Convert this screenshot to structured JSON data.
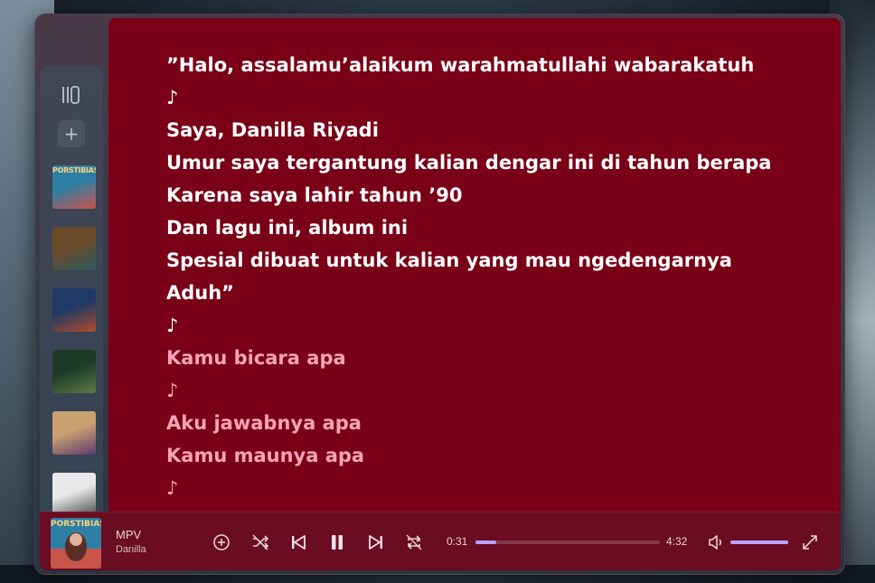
{
  "colors": {
    "lyrics_background": "#790016",
    "player_background": "#6a0c22",
    "lyric_active": "#ffffff",
    "lyric_upcoming": "#f6a3b4",
    "accent": "#b9a3ff"
  },
  "sidebar": {
    "library_icon": "library-icon",
    "add_icon": "plus-icon",
    "albums": [
      {
        "name": "album-porstibias",
        "caption": "PORSTIBIAS",
        "c1": "#2e7fa5",
        "c2": "#c9544a"
      },
      {
        "name": "album-2",
        "caption": "",
        "c1": "#6b4a2a",
        "c2": "#2e5b5e"
      },
      {
        "name": "album-3",
        "caption": "",
        "c1": "#1f3a66",
        "c2": "#b24a2a"
      },
      {
        "name": "album-4",
        "caption": "",
        "c1": "#1e3b28",
        "c2": "#5c7a46"
      },
      {
        "name": "album-5",
        "caption": "",
        "c1": "#c9a070",
        "c2": "#5a3a6c"
      },
      {
        "name": "album-6",
        "caption": "",
        "c1": "#e8e8e8",
        "c2": "#4a4a4a"
      }
    ]
  },
  "lyrics": [
    {
      "text": "”Halo, assalamu’alaikum warahmatullahi wabarakatuh",
      "state": "past"
    },
    {
      "text": "♪",
      "state": "past"
    },
    {
      "text": "Saya, Danilla Riyadi",
      "state": "past"
    },
    {
      "text": "Umur saya tergantung kalian dengar ini di tahun berapa",
      "state": "past"
    },
    {
      "text": "Karena saya lahir tahun ’90",
      "state": "past"
    },
    {
      "text": "Dan lagu ini, album ini",
      "state": "past"
    },
    {
      "text": "Spesial dibuat untuk kalian yang mau ngedengarnya",
      "state": "past"
    },
    {
      "text": "Aduh”",
      "state": "past"
    },
    {
      "text": "♪",
      "state": "past"
    },
    {
      "text": "Kamu bicara apa",
      "state": "upcoming"
    },
    {
      "text": "♪",
      "state": "upcoming"
    },
    {
      "text": "Aku jawabnya apa",
      "state": "upcoming"
    },
    {
      "text": "Kamu maunya apa",
      "state": "upcoming"
    },
    {
      "text": "♪",
      "state": "upcoming"
    }
  ],
  "player": {
    "title": "MPV",
    "artist": "Danilla",
    "cover_caption": "PORSTIBIAS",
    "elapsed": "0:31",
    "duration": "4:32",
    "progress_fraction": 0.114,
    "volume_fraction": 1.0,
    "controls": [
      {
        "name": "add-to-library-button",
        "icon": "plus-circle-icon"
      },
      {
        "name": "shuffle-button",
        "icon": "shuffle-off-icon"
      },
      {
        "name": "previous-button",
        "icon": "skip-back-icon"
      },
      {
        "name": "pause-button",
        "icon": "pause-icon"
      },
      {
        "name": "next-button",
        "icon": "skip-forward-icon"
      },
      {
        "name": "repeat-button",
        "icon": "repeat-off-icon"
      }
    ],
    "volume_icon": "volume-icon",
    "fullscreen_icon": "fullscreen-icon"
  }
}
